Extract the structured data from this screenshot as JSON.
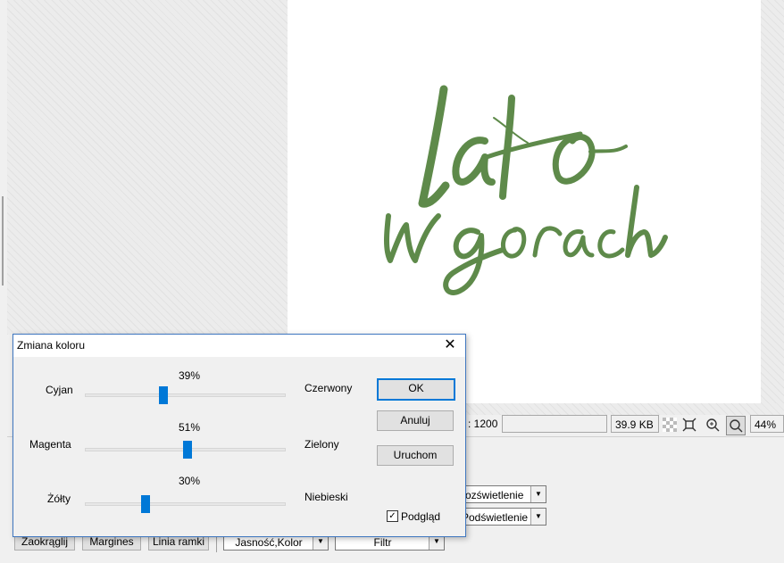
{
  "status": {
    "dimension": ": 1200",
    "size": "39.9 KB",
    "zoom": "44%"
  },
  "panel": {
    "combo_top": "rozświetlenie",
    "combo_bottom": "Podświetlenie",
    "btn_round": "Zaokrąglij",
    "btn_margins": "Margines",
    "btn_frame": "Linia ramki",
    "combo_brightness": "Jasność,Kolor",
    "combo_filter": "Filtr"
  },
  "dialog": {
    "title": "Zmiana koloru",
    "ok": "OK",
    "cancel": "Anuluj",
    "run": "Uruchom",
    "preview": "Podgląd",
    "preview_checked": true,
    "sliders": [
      {
        "left": "Cyjan",
        "right": "Czerwony",
        "percent_label": "39%",
        "value": 39
      },
      {
        "left": "Magenta",
        "right": "Zielony",
        "percent_label": "51%",
        "value": 51
      },
      {
        "left": "Żółty",
        "right": "Niebieski",
        "percent_label": "30%",
        "value": 30
      }
    ]
  },
  "colors": {
    "accent": "#0078d7",
    "logo_green": "#5e8a4a"
  }
}
